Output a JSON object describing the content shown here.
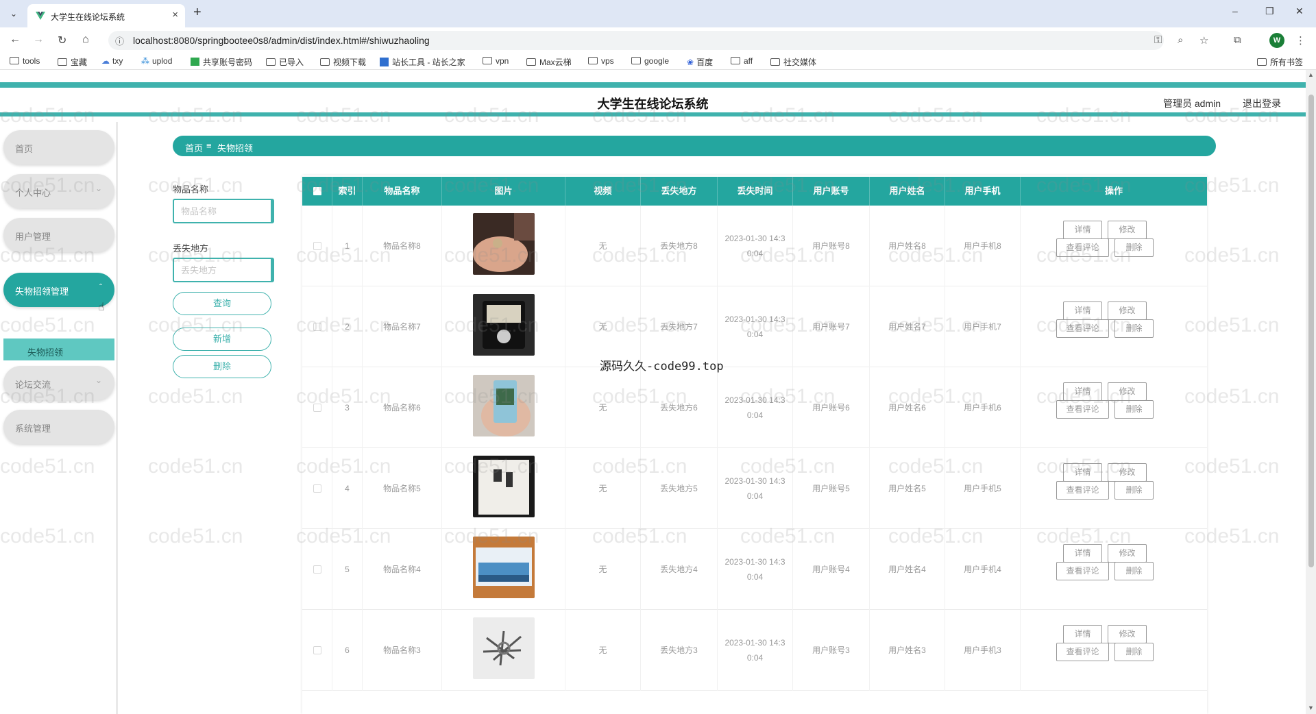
{
  "browser": {
    "tab_title": "大学生在线论坛系统",
    "url": "localhost:8080/springbootee0s8/admin/dist/index.html#/shiwuzhaoling",
    "profile_initial": "W",
    "bookmarks": [
      "tools",
      "宝藏",
      "txy",
      "uplod",
      "共享账号密码",
      "已导入",
      "视频下载",
      "站长工具 - 站长之家",
      "vpn",
      "Max云梯",
      "vps",
      "google",
      "百度",
      "aff",
      "社交媒体"
    ],
    "all_bookmarks": "所有书签"
  },
  "header": {
    "title": "大学生在线论坛系统",
    "admin_label": "管理员 admin",
    "logout": "退出登录"
  },
  "sidebar": {
    "items": [
      {
        "label": "首页"
      },
      {
        "label": "个人中心"
      },
      {
        "label": "用户管理"
      },
      {
        "label": "失物招领管理"
      },
      {
        "label": "论坛交流"
      },
      {
        "label": "系统管理"
      }
    ],
    "sub_item": "失物招领"
  },
  "breadcrumb": {
    "home": "首页",
    "separator": "≡",
    "current": "失物招领"
  },
  "filters": {
    "name_label": "物品名称",
    "name_placeholder": "物品名称",
    "place_label": "丢失地方",
    "place_placeholder": "丢失地方",
    "query_button": "查询",
    "add_button": "新增",
    "delete_button": "删除"
  },
  "table": {
    "headers": [
      "索引",
      "物品名称",
      "图片",
      "视频",
      "丢失地方",
      "丢失时间",
      "用户账号",
      "用户姓名",
      "用户手机",
      "操作"
    ],
    "rows": [
      {
        "index": "1",
        "name": "物品名称8",
        "video": "无",
        "place": "丢失地方8",
        "time1": "2023-01-30 14:3",
        "time2": "0:04",
        "account": "用户账号8",
        "username": "用户姓名8",
        "phone": "用户手机8"
      },
      {
        "index": "2",
        "name": "物品名称7",
        "video": "无",
        "place": "丢失地方7",
        "time1": "2023-01-30 14:3",
        "time2": "0:04",
        "account": "用户账号7",
        "username": "用户姓名7",
        "phone": "用户手机7"
      },
      {
        "index": "3",
        "name": "物品名称6",
        "video": "无",
        "place": "丢失地方6",
        "time1": "2023-01-30 14:3",
        "time2": "0:04",
        "account": "用户账号6",
        "username": "用户姓名6",
        "phone": "用户手机6"
      },
      {
        "index": "4",
        "name": "物品名称5",
        "video": "无",
        "place": "丢失地方5",
        "time1": "2023-01-30 14:3",
        "time2": "0:04",
        "account": "用户账号5",
        "username": "用户姓名5",
        "phone": "用户手机5"
      },
      {
        "index": "5",
        "name": "物品名称4",
        "video": "无",
        "place": "丢失地方4",
        "time1": "2023-01-30 14:3",
        "time2": "0:04",
        "account": "用户账号4",
        "username": "用户姓名4",
        "phone": "用户手机4"
      },
      {
        "index": "6",
        "name": "物品名称3",
        "video": "无",
        "place": "丢失地方3",
        "time1": "2023-01-30 14:3",
        "time2": "0:04",
        "account": "用户账号3",
        "username": "用户姓名3",
        "phone": "用户手机3"
      }
    ],
    "op_labels": {
      "detail": "详情",
      "edit": "修改",
      "comments": "查看评论",
      "delete": "删除"
    }
  },
  "overlay": {
    "watermark": "code51.cn",
    "center_mark": "源码久久-code99.top"
  },
  "colors": {
    "accent": "#24a69f",
    "accent_light": "#3fb2ad",
    "sub_menu": "#5fc8c1"
  }
}
